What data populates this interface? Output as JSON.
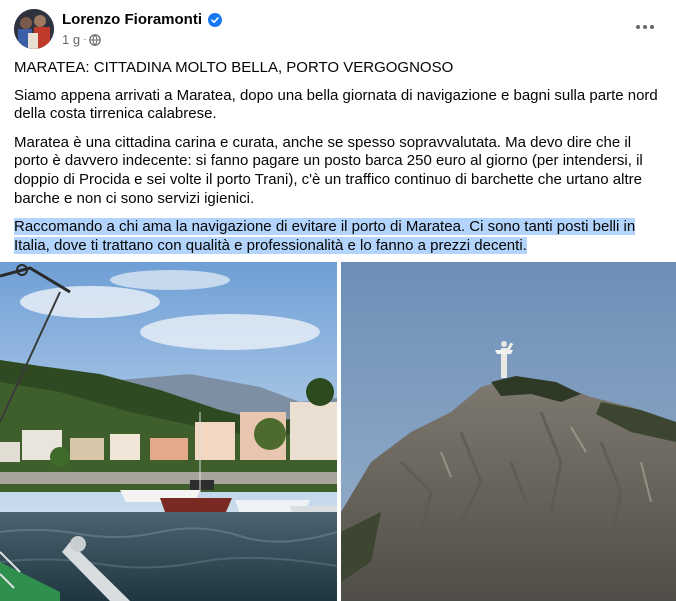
{
  "post": {
    "author": "Lorenzo Fioramonti",
    "timestamp": "1 g",
    "separator": "·",
    "privacy_icon": "globe-icon",
    "verified_icon": "verified-badge-icon",
    "more_icon": "more-options-icon",
    "title_line": "MARATEA: CITTADINA MOLTO BELLA, PORTO VERGOGNOSO",
    "paragraph_1": "Siamo appena arrivati a Maratea, dopo una bella giornata di navigazione e bagni sulla parte nord della costa tirrenica calabrese.",
    "paragraph_2": "Maratea è una cittadina carina e curata, anche se spesso sopravvalutata. Ma devo dire che il porto è davvero indecente: si fanno pagare un posto barca 250 euro al giorno (per intendersi, il doppio di Procida e sei volte il porto Trani), c'è un traffico continuo di barchette che urtano altre barche e non ci sono servizi igienici.",
    "paragraph_3": "Raccomando a chi ama la navigazione di evitare il porto di Maratea. Ci sono tanti posti belli in Italia, dove ti trattano con qualità e professionalità e lo fanno a prezzi decenti."
  },
  "colors": {
    "text": "#050505",
    "secondary": "#65676b",
    "verified": "#1877f2",
    "selection": "#b3d4fc"
  },
  "photos": [
    {
      "name": "harbor-photo",
      "subject": "Maratea harbor with boats and hillside town"
    },
    {
      "name": "statue-mountain-photo",
      "subject": "Christ the Redeemer statue on rocky mountain peak"
    }
  ]
}
